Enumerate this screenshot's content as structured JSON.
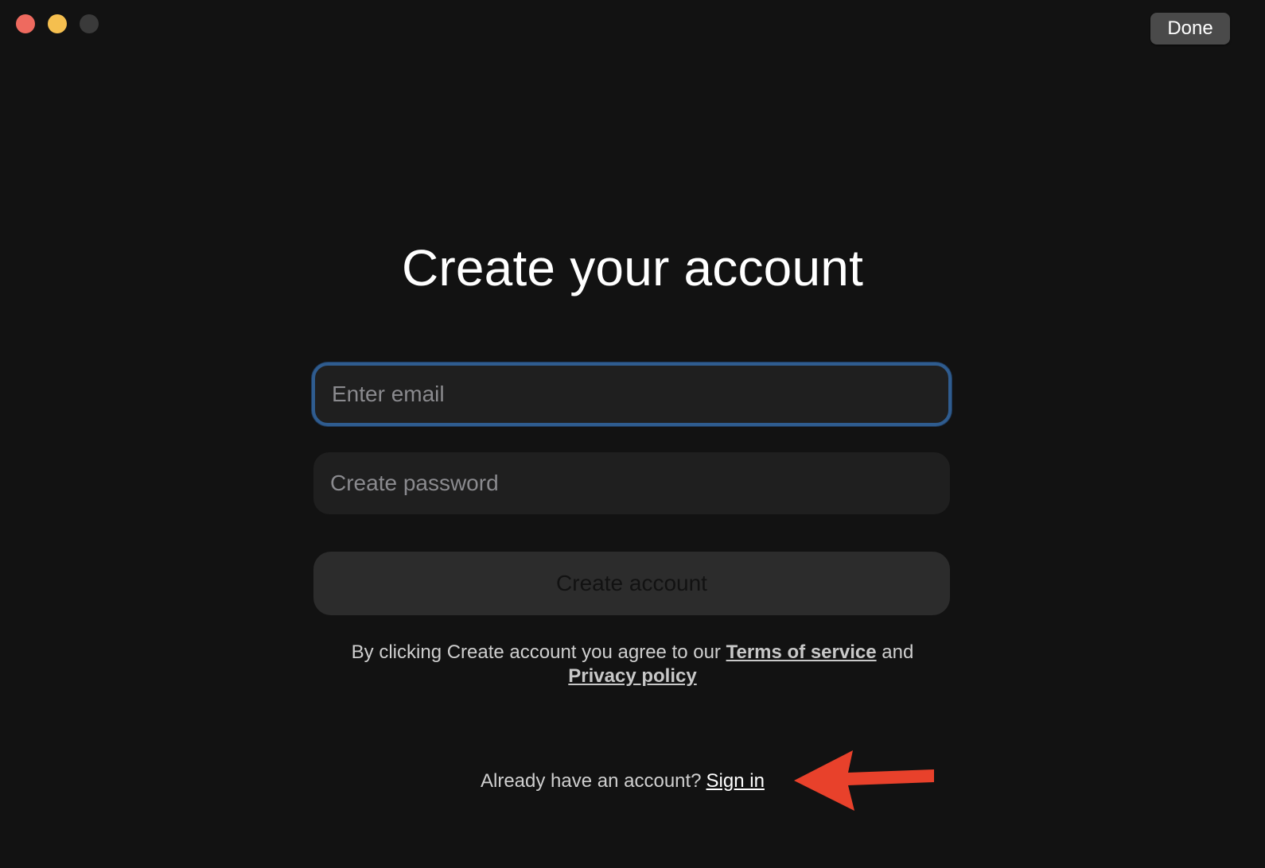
{
  "window": {
    "done_label": "Done"
  },
  "form": {
    "title": "Create your account",
    "email_placeholder": "Enter email",
    "password_placeholder": "Create password",
    "submit_label": "Create account"
  },
  "legal": {
    "prefix": "By clicking Create account you agree to our",
    "terms_link": "Terms of service",
    "conjunction": "and",
    "privacy_link": "Privacy policy"
  },
  "signin": {
    "prompt": "Already have an account?",
    "link": "Sign in"
  },
  "annotation": {
    "arrow_color": "#e8412b",
    "arrow_icon": "left-arrow-icon"
  },
  "colors": {
    "background": "#121212",
    "focus_ring": "#2f5c8f",
    "traffic_close": "#ee6a5f",
    "traffic_minimize": "#f5bf4f",
    "traffic_zoom": "#3a3a3a"
  }
}
